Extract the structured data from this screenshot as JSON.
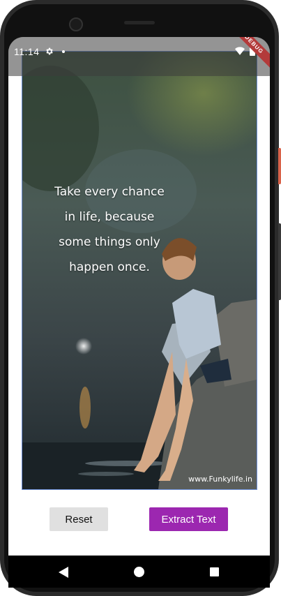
{
  "status_bar": {
    "time": "11:14",
    "debug_label": "DEBUG"
  },
  "image": {
    "quote": "Take every chance in life, because some things only happen once.",
    "watermark": "www.Funkylife.in"
  },
  "buttons": {
    "reset_label": "Reset",
    "extract_label": "Extract Text"
  },
  "colors": {
    "accent": "#9c27b0",
    "reset_bg": "#e0e0e0",
    "image_border": "#6c8fd8"
  },
  "icons": {
    "status": [
      "gear-icon",
      "dot-icon",
      "wifi-icon",
      "battery-icon"
    ],
    "nav": [
      "back-icon",
      "home-icon",
      "recents-icon"
    ]
  }
}
